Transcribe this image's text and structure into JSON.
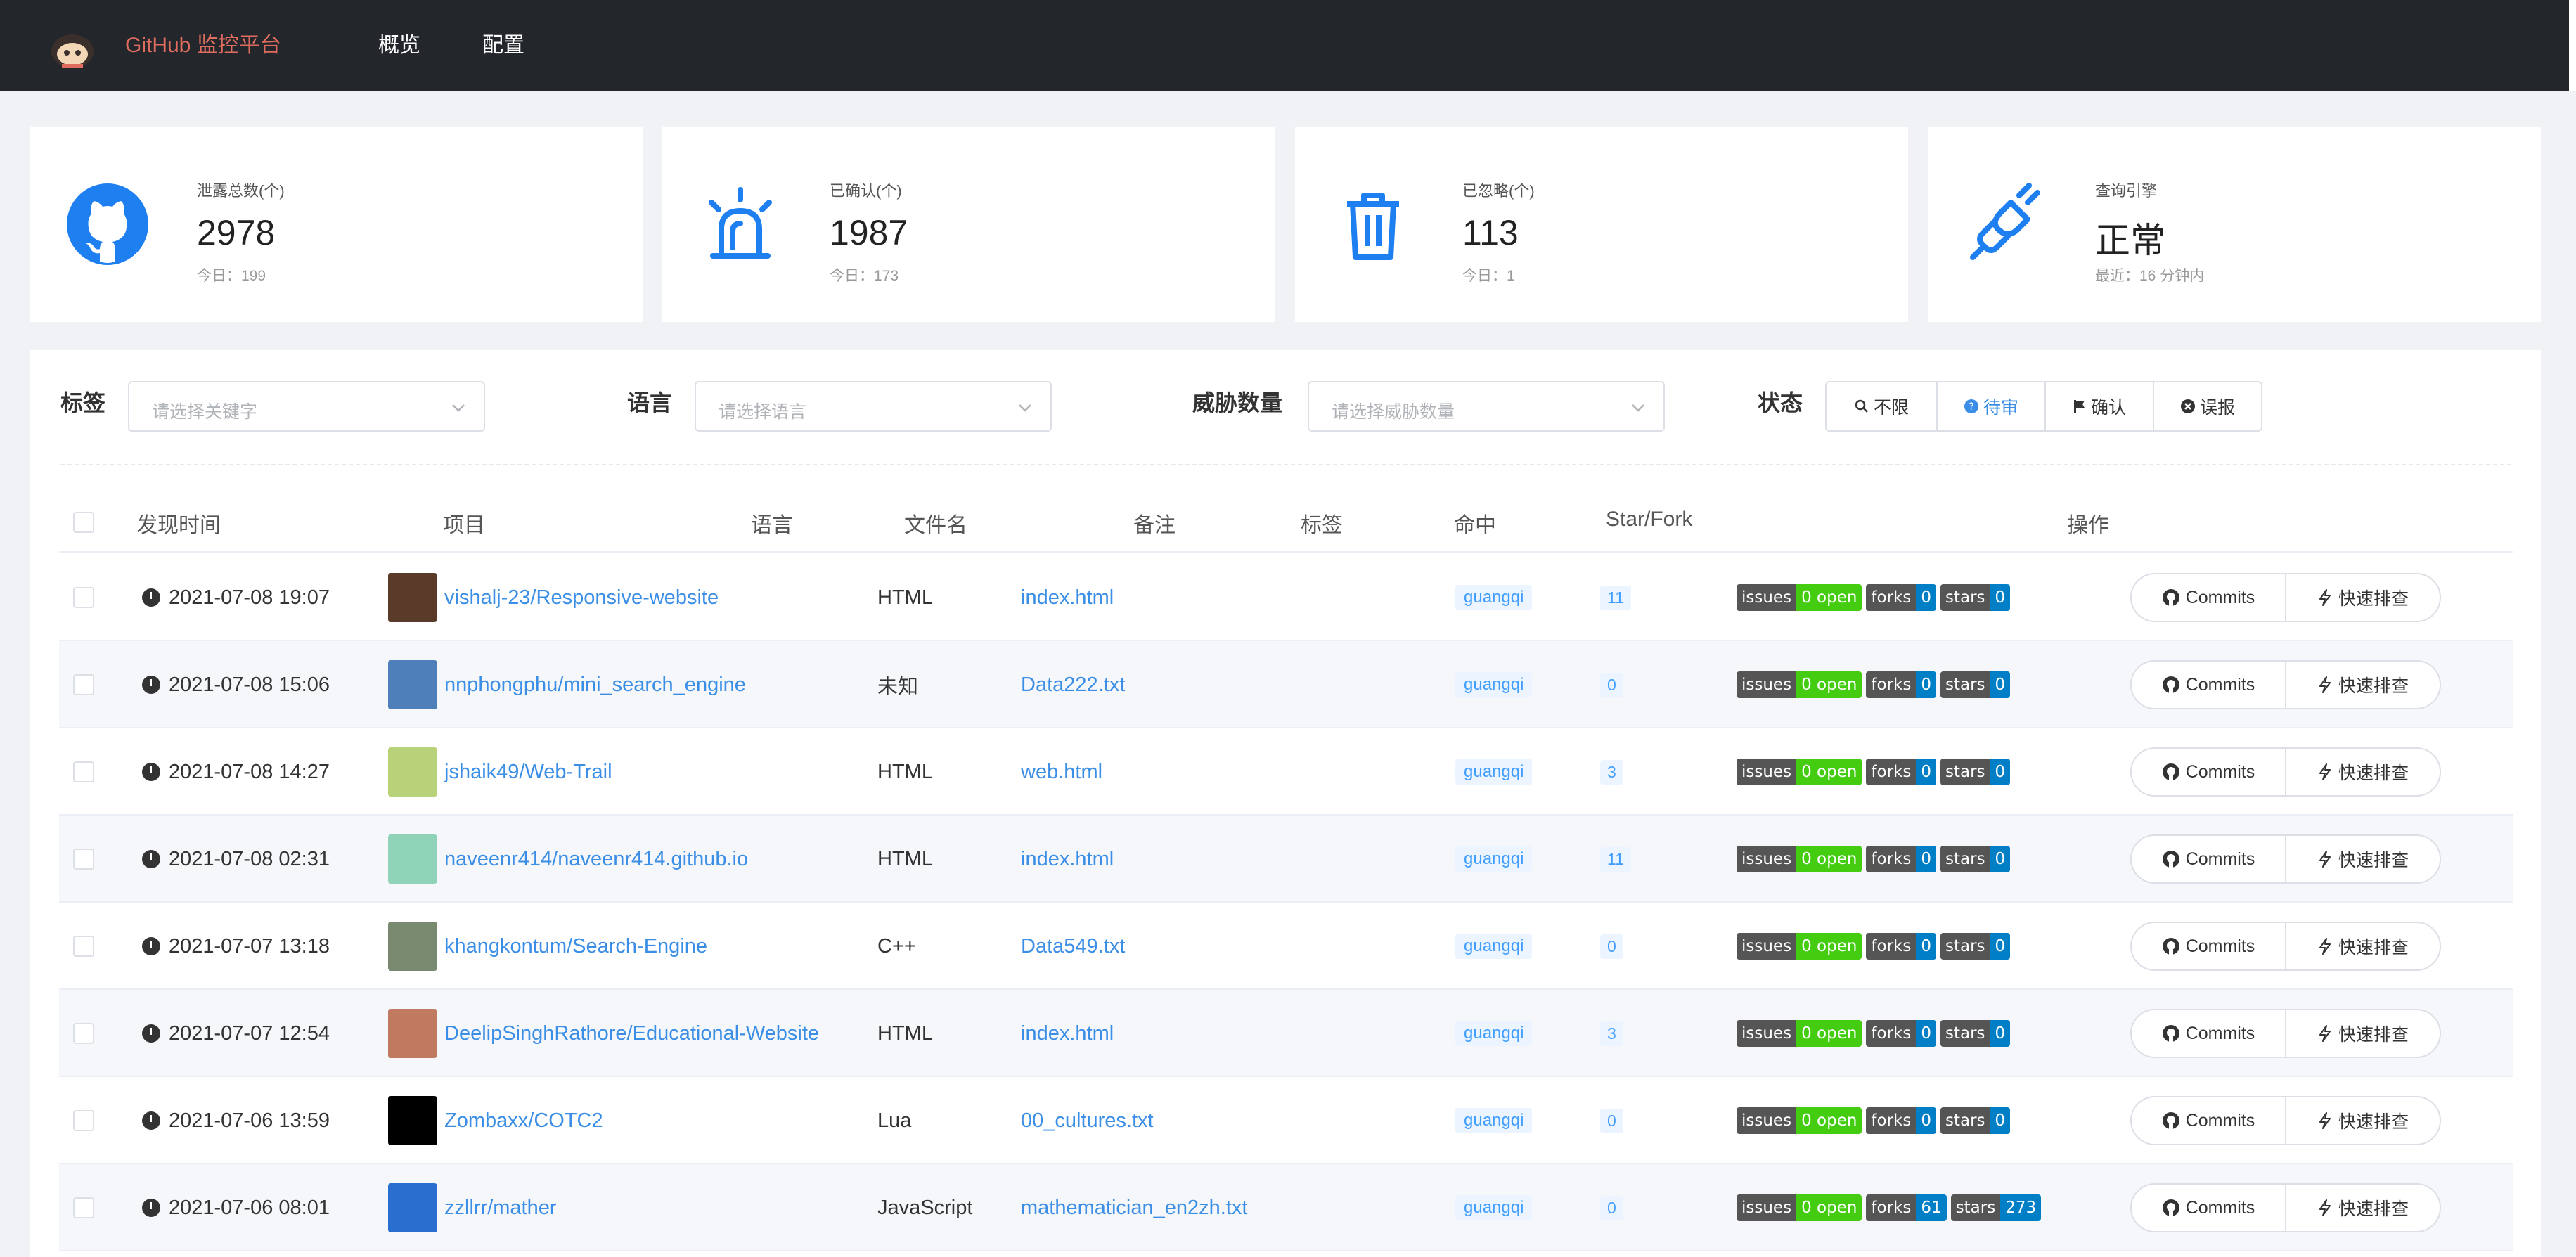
{
  "nav": {
    "brand": "GitHub 监控平台",
    "items": [
      "概览",
      "配置"
    ]
  },
  "cards": [
    {
      "icon": "github-icon",
      "label": "泄露总数(个)",
      "value": "2978",
      "sub": "今日：199",
      "color": "#1e7ff0"
    },
    {
      "icon": "alarm-light-icon",
      "label": "已确认(个)",
      "value": "1987",
      "sub": "今日：173",
      "color": "#1e7ff0"
    },
    {
      "icon": "trash-icon",
      "label": "已忽略(个)",
      "value": "113",
      "sub": "今日：1",
      "color": "#1e7ff0"
    },
    {
      "icon": "plug-icon",
      "label": "查询引擎",
      "value": "正常",
      "sub": "最近：16 分钟内",
      "color": "#1e7ff0"
    }
  ],
  "filters": {
    "tag_label": "标签",
    "tag_placeholder": "请选择关键字",
    "lang_label": "语言",
    "lang_placeholder": "请选择语言",
    "threat_label": "威胁数量",
    "threat_placeholder": "请选择威胁数量",
    "status_label": "状态",
    "status_options": [
      {
        "icon": "search-icon",
        "label": "不限",
        "active": false
      },
      {
        "icon": "question-circle-icon",
        "label": "待审",
        "active": true
      },
      {
        "icon": "flag-icon",
        "label": "确认",
        "active": false
      },
      {
        "icon": "close-circle-icon",
        "label": "误报",
        "active": false
      }
    ]
  },
  "table": {
    "columns": [
      "发现时间",
      "项目",
      "语言",
      "文件名",
      "备注",
      "标签",
      "命中",
      "Star/Fork",
      "操作"
    ],
    "rows": [
      {
        "time": "2021-07-08 19:07",
        "project": "vishalj-23/Responsive-website",
        "lang": "HTML",
        "file": "index.html",
        "hit": "guangqi",
        "stars": "11",
        "issues": "0 open",
        "forks": "0",
        "stargazers": "0",
        "avatar": "#5a3b2a"
      },
      {
        "time": "2021-07-08 15:06",
        "project": "nnphongphu/mini_search_engine",
        "lang": "未知",
        "file": "Data222.txt",
        "hit": "guangqi",
        "stars": "0",
        "issues": "0 open",
        "forks": "0",
        "stargazers": "0",
        "avatar": "#4f7fb8"
      },
      {
        "time": "2021-07-08 14:27",
        "project": "jshaik49/Web-Trail",
        "lang": "HTML",
        "file": "web.html",
        "hit": "guangqi",
        "stars": "3",
        "issues": "0 open",
        "forks": "0",
        "stargazers": "0",
        "avatar": "#b9d27a"
      },
      {
        "time": "2021-07-08 02:31",
        "project": "naveenr414/naveenr414.github.io",
        "lang": "HTML",
        "file": "index.html",
        "hit": "guangqi",
        "stars": "11",
        "issues": "0 open",
        "forks": "0",
        "stargazers": "0",
        "avatar": "#8fd4b8"
      },
      {
        "time": "2021-07-07 13:18",
        "project": "khangkontum/Search-Engine",
        "lang": "C++",
        "file": "Data549.txt",
        "hit": "guangqi",
        "stars": "0",
        "issues": "0 open",
        "forks": "0",
        "stargazers": "0",
        "avatar": "#7a8a70"
      },
      {
        "time": "2021-07-07 12:54",
        "project": "DeelipSinghRathore/Educational-Website",
        "lang": "HTML",
        "file": "index.html",
        "hit": "guangqi",
        "stars": "3",
        "issues": "0 open",
        "forks": "0",
        "stargazers": "0",
        "avatar": "#c07a60"
      },
      {
        "time": "2021-07-06 13:59",
        "project": "Zombaxx/COTC2",
        "lang": "Lua",
        "file": "00_cultures.txt",
        "hit": "guangqi",
        "stars": "0",
        "issues": "0 open",
        "forks": "0",
        "stargazers": "0",
        "avatar": "#000000"
      },
      {
        "time": "2021-07-06 08:01",
        "project": "zzllrr/mather",
        "lang": "JavaScript",
        "file": "mathematician_en2zh.txt",
        "hit": "guangqi",
        "stars": "0",
        "issues": "0 open",
        "forks": "61",
        "stargazers": "273",
        "avatar": "#2a6fd0"
      }
    ],
    "badge_labels": {
      "issues": "issues",
      "forks": "forks",
      "stars": "stars"
    },
    "actions": {
      "commits": "Commits",
      "quick": "快速排查"
    }
  }
}
